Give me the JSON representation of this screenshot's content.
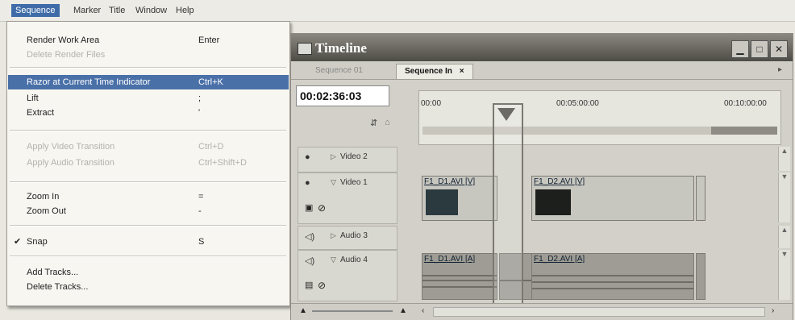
{
  "menubar": {
    "items": [
      "Sequence",
      "Marker",
      "Title",
      "Window",
      "Help"
    ],
    "active": "Sequence"
  },
  "sequence_menu": {
    "items": [
      {
        "label": "Render Work Area",
        "shortcut": "Enter",
        "disabled": false
      },
      {
        "label": "Delete Render Files",
        "shortcut": "",
        "disabled": true
      },
      {
        "label": "Razor at Current Time Indicator",
        "shortcut": "Ctrl+K",
        "disabled": false,
        "highlighted": true
      },
      {
        "label": "Lift",
        "shortcut": ";",
        "disabled": false
      },
      {
        "label": "Extract",
        "shortcut": "'",
        "disabled": false
      },
      {
        "label": "Apply Video Transition",
        "shortcut": "Ctrl+D",
        "disabled": true
      },
      {
        "label": "Apply Audio Transition",
        "shortcut": "Ctrl+Shift+D",
        "disabled": true
      },
      {
        "label": "Zoom In",
        "shortcut": "=",
        "disabled": false
      },
      {
        "label": "Zoom Out",
        "shortcut": "-",
        "disabled": false
      },
      {
        "label": "Snap",
        "shortcut": "S",
        "disabled": false,
        "checked": true
      },
      {
        "label": "Add Tracks...",
        "shortcut": "",
        "disabled": false
      },
      {
        "label": "Delete Tracks...",
        "shortcut": "",
        "disabled": false
      }
    ]
  },
  "timeline": {
    "title": "Timeline",
    "tabs": [
      {
        "label": "Sequence 01",
        "active": false
      },
      {
        "label": "Sequence In",
        "active": true
      }
    ],
    "timecode": "00:02:36:03",
    "ruler_ticks": [
      "00:00",
      "00:05:00:00",
      "00:10:00:00"
    ],
    "tracks": [
      {
        "name": "Video 2",
        "type": "video",
        "expanded": false
      },
      {
        "name": "Video 1",
        "type": "video",
        "expanded": true
      },
      {
        "name": "Audio 3",
        "type": "audio",
        "expanded": false
      },
      {
        "name": "Audio 4",
        "type": "audio",
        "expanded": true
      }
    ],
    "clips": {
      "video1": [
        "F1_D1.AVI [V]",
        "F1_D2.AVI [V]"
      ],
      "audio4": [
        "F1_D1.AVI [A]",
        "F1_D2.AVI [A]"
      ]
    }
  }
}
